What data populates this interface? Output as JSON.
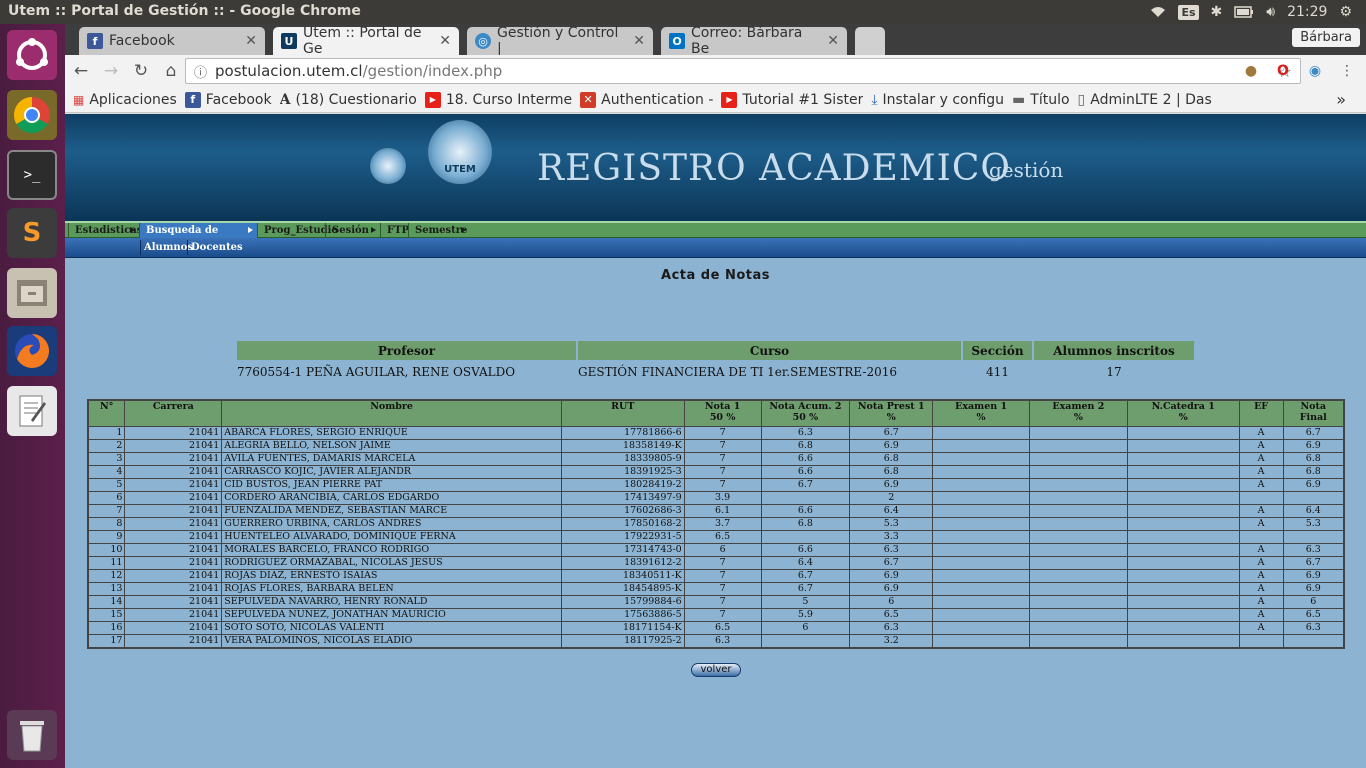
{
  "system": {
    "window_title": "Utem :: Portal de Gestión :: - Google Chrome",
    "keyboard_layout": "Es",
    "clock": "21:29"
  },
  "browser": {
    "profile": "Bárbara",
    "tabs": [
      {
        "label": "Facebook",
        "icon": "facebook-icon"
      },
      {
        "label": "Utem :: Portal de Ge",
        "icon": "utem-icon"
      },
      {
        "label": "Gestión y Control | ",
        "icon": "globe-icon"
      },
      {
        "label": "Correo: Bárbara Be",
        "icon": "outlook-icon"
      }
    ],
    "url_domain": "postulacion.utem.cl",
    "url_path": "/gestion/index.php",
    "bookmarks": [
      {
        "label": "Aplicaciones",
        "icon": "apps-grid-icon"
      },
      {
        "label": "Facebook",
        "icon": "facebook-icon"
      },
      {
        "label": "(18) Cuestionario",
        "icon": "a-letter-icon"
      },
      {
        "label": "18. Curso Interme",
        "icon": "youtube-icon"
      },
      {
        "label": "Authentication - ",
        "icon": "authentication-icon"
      },
      {
        "label": "Tutorial #1 Sister",
        "icon": "youtube-icon"
      },
      {
        "label": "Instalar y configu",
        "icon": "install-icon"
      },
      {
        "label": "Título",
        "icon": "folder-icon"
      },
      {
        "label": "AdminLTE 2 | Das",
        "icon": "page-icon"
      }
    ],
    "bookmarks_more": "»"
  },
  "site": {
    "banner_title": "REGISTRO ACADEMICO",
    "banner_subtitle": "gestión",
    "logo_text": "UTEM",
    "menu": [
      "Estadisticas",
      "Busqueda de Personas",
      "Prog_Estudio",
      "Sesión",
      "FTP",
      "Semestre"
    ],
    "submenu": [
      "Alumnos",
      "Docentes"
    ],
    "page_heading": "Acta de Notas",
    "info_headers": [
      "Profesor",
      "Curso",
      "Sección",
      "Alumnos inscritos"
    ],
    "info_values": [
      "7760554-1 PEÑA AGUILAR, RENE OSVALDO",
      "GESTIÓN FINANCIERA DE TI 1er.SEMESTRE-2016",
      "411",
      "17"
    ],
    "grade_headers": [
      "N°",
      "Carrera",
      "Nombre",
      "RUT",
      "Nota 1\n50 %",
      "Nota Acum. 2\n50 %",
      "Nota Prest 1\n%",
      "Examen 1\n%",
      "Examen 2\n%",
      "N.Catedra 1\n%",
      "EF",
      "Nota\nFinal"
    ],
    "rows": [
      [
        "1",
        "21041",
        "ABARCA FLORES, SERGIO ENRIQUE",
        "17781866-6",
        "7",
        "6.3",
        "6.7",
        "",
        "",
        "",
        "A",
        "6.7"
      ],
      [
        "2",
        "21041",
        "ALEGRIA BELLO, NELSON JAIME",
        "18358149-K",
        "7",
        "6.8",
        "6.9",
        "",
        "",
        "",
        "A",
        "6.9"
      ],
      [
        "3",
        "21041",
        "AVILA FUENTES, DAMARIS MARCELA",
        "18339805-9",
        "7",
        "6.6",
        "6.8",
        "",
        "",
        "",
        "A",
        "6.8"
      ],
      [
        "4",
        "21041",
        "CARRASCO KOJIC, JAVIER ALEJANDR",
        "18391925-3",
        "7",
        "6.6",
        "6.8",
        "",
        "",
        "",
        "A",
        "6.8"
      ],
      [
        "5",
        "21041",
        "CID BUSTOS, JEAN PIERRE PAT",
        "18028419-2",
        "7",
        "6.7",
        "6.9",
        "",
        "",
        "",
        "A",
        "6.9"
      ],
      [
        "6",
        "21041",
        "CORDERO ARANCIBIA, CARLOS EDGARDO",
        "17413497-9",
        "3.9",
        "",
        "2",
        "",
        "",
        "",
        "",
        ""
      ],
      [
        "7",
        "21041",
        "FUENZALIDA MENDEZ, SEBASTIAN MARCE",
        "17602686-3",
        "6.1",
        "6.6",
        "6.4",
        "",
        "",
        "",
        "A",
        "6.4"
      ],
      [
        "8",
        "21041",
        "GUERRERO URBINA, CARLOS ANDRES",
        "17850168-2",
        "3.7",
        "6.8",
        "5.3",
        "",
        "",
        "",
        "A",
        "5.3"
      ],
      [
        "9",
        "21041",
        "HUENTELEO ALVARADO, DOMINIQUE FERNA",
        "17922931-5",
        "6.5",
        "",
        "3.3",
        "",
        "",
        "",
        "",
        ""
      ],
      [
        "10",
        "21041",
        "MORALES BARCELO, FRANCO RODRIGO",
        "17314743-0",
        "6",
        "6.6",
        "6.3",
        "",
        "",
        "",
        "A",
        "6.3"
      ],
      [
        "11",
        "21041",
        "RODRIGUEZ ORMAZABAL, NICOLAS JESUS",
        "18391612-2",
        "7",
        "6.4",
        "6.7",
        "",
        "",
        "",
        "A",
        "6.7"
      ],
      [
        "12",
        "21041",
        "ROJAS DIAZ, ERNESTO ISAIAS",
        "18340511-K",
        "7",
        "6.7",
        "6.9",
        "",
        "",
        "",
        "A",
        "6.9"
      ],
      [
        "13",
        "21041",
        "ROJAS FLORES, BARBARA BELEN",
        "18454895-K",
        "7",
        "6.7",
        "6.9",
        "",
        "",
        "",
        "A",
        "6.9"
      ],
      [
        "14",
        "21041",
        "SEPULVEDA NAVARRO, HENRY RONALD",
        "15799884-6",
        "7",
        "5",
        "6",
        "",
        "",
        "",
        "A",
        "6"
      ],
      [
        "15",
        "21041",
        "SEPULVEDA NUÑEZ, JONATHAN MAURICIO",
        "17563886-5",
        "7",
        "5.9",
        "6.5",
        "",
        "",
        "",
        "A",
        "6.5"
      ],
      [
        "16",
        "21041",
        "SOTO SOTO, NICOLAS VALENTI",
        "18171154-K",
        "6.5",
        "6",
        "6.3",
        "",
        "",
        "",
        "A",
        "6.3"
      ],
      [
        "17",
        "21041",
        "VERA PALOMINOS, NICOLAS ELADIO",
        "18117925-2",
        "6.3",
        "",
        "3.2",
        "",
        "",
        "",
        "",
        ""
      ]
    ],
    "back_button": "volver"
  },
  "colors": {
    "launcher": "#5c1f4b",
    "page_background": "#8cb4d2",
    "table_header_green": "#6e9e6e",
    "menu_green": "#5a9a5a",
    "submenu_blue": "#1a4c8c"
  }
}
